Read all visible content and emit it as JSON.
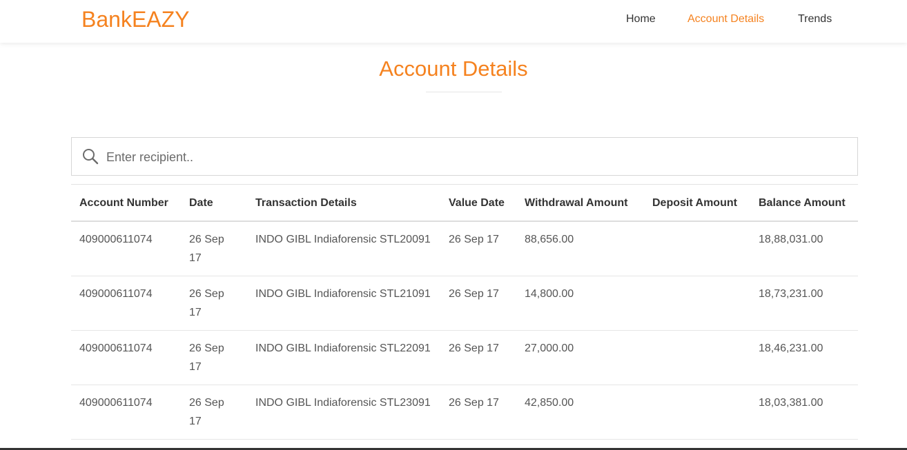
{
  "brand": {
    "name": "BankEAZY",
    "color": "#f5821f"
  },
  "nav": {
    "items": [
      {
        "label": "Home",
        "active": false
      },
      {
        "label": "Account Details",
        "active": true
      },
      {
        "label": "Trends",
        "active": false
      }
    ]
  },
  "page": {
    "title": "Account Details"
  },
  "search": {
    "placeholder": "Enter recipient..",
    "value": "",
    "icon": "search-icon"
  },
  "table": {
    "headers": {
      "account_number": "Account Number",
      "date": "Date",
      "transaction_details": "Transaction Details",
      "value_date": "Value Date",
      "withdrawal_amount": "Withdrawal Amount",
      "deposit_amount": "Deposit Amount",
      "balance_amount": "Balance Amount"
    },
    "rows": [
      {
        "account_number": "409000611074",
        "date": "26 Sep 17",
        "transaction_details": "INDO GIBL Indiaforensic STL20091",
        "value_date": "26 Sep 17",
        "withdrawal_amount": "88,656.00",
        "deposit_amount": "",
        "balance_amount": "18,88,031.00"
      },
      {
        "account_number": "409000611074",
        "date": "26 Sep 17",
        "transaction_details": "INDO GIBL Indiaforensic STL21091",
        "value_date": "26 Sep 17",
        "withdrawal_amount": "14,800.00",
        "deposit_amount": "",
        "balance_amount": "18,73,231.00"
      },
      {
        "account_number": "409000611074",
        "date": "26 Sep 17",
        "transaction_details": "INDO GIBL Indiaforensic STL22091",
        "value_date": "26 Sep 17",
        "withdrawal_amount": "27,000.00",
        "deposit_amount": "",
        "balance_amount": "18,46,231.00"
      },
      {
        "account_number": "409000611074",
        "date": "26 Sep 17",
        "transaction_details": "INDO GIBL Indiaforensic STL23091",
        "value_date": "26 Sep 17",
        "withdrawal_amount": "42,850.00",
        "deposit_amount": "",
        "balance_amount": "18,03,381.00"
      }
    ]
  }
}
